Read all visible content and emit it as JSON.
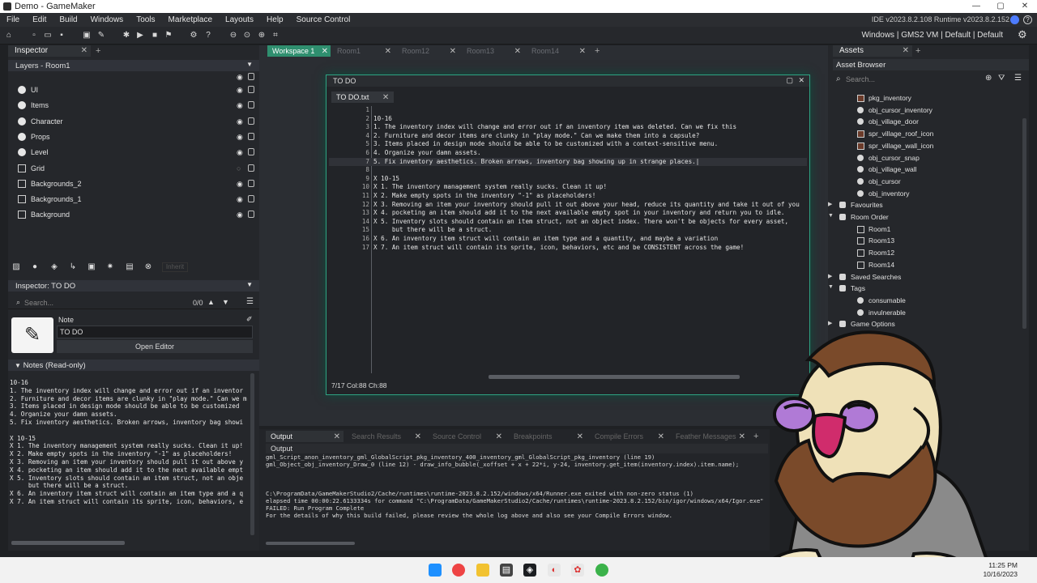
{
  "window": {
    "title": "Demo - GameMaker",
    "controls": [
      "—",
      "▢",
      "✕"
    ]
  },
  "menu": {
    "items": [
      "File",
      "Edit",
      "Build",
      "Windows",
      "Tools",
      "Marketplace",
      "Layouts",
      "Help",
      "Source Control"
    ],
    "version": "IDE v2023.8.2.108  Runtime v2023.8.2.152"
  },
  "toolbar": {
    "target": "Windows | GMS2 VM | Default | Default"
  },
  "inspector": {
    "tab": "Inspector",
    "layers_header": "Layers - Room1",
    "layers": [
      {
        "name": "UI",
        "icon": "circ",
        "visible": true
      },
      {
        "name": "Items",
        "icon": "circ",
        "visible": true
      },
      {
        "name": "Character",
        "icon": "circ",
        "visible": true
      },
      {
        "name": "Props",
        "icon": "circ",
        "visible": true
      },
      {
        "name": "Level",
        "icon": "circ",
        "visible": true
      },
      {
        "name": "Grid",
        "icon": "sq",
        "visible": false
      },
      {
        "name": "Backgrounds_2",
        "icon": "sq",
        "visible": true
      },
      {
        "name": "Backgrounds_1",
        "icon": "sq",
        "visible": true
      },
      {
        "name": "Background",
        "icon": "sq",
        "visible": true
      }
    ],
    "inherit_label": "Inherit",
    "inspector_header": "Inspector: TO DO",
    "search_placeholder": "Search...",
    "search_count": "0/0",
    "note_label": "Note",
    "note_name": "TO DO",
    "open_editor": "Open Editor",
    "notes_header": "Notes (Read-only)",
    "notes_text": "10-16\n1. The inventory index will change and error out if an inventor\n2. Furniture and decor items are clunky in \"play mode.\" Can we m\n3. Items placed in design mode should be able to be customized\n4. Organize your damn assets.\n5. Fix inventory aesthetics. Broken arrows, inventory bag showi\n\nX 10-15\nX 1. The inventory management system really sucks. Clean it up!\nX 2. Make empty spots in the inventory \"-1\" as placeholders!\nX 3. Removing an item your inventory should pull it out above y\nX 4. pocketing an item should add it to the next available empt\nX 5. Inventory slots should contain an item struct, not an obje\n     but there will be a struct.\nX 6. An inventory item struct will contain an item type and a q\nX 7. An item struct will contain its sprite, icon, behaviors, e"
  },
  "workspace": {
    "tabs": [
      "Workspace 1",
      "Room1",
      "Room12",
      "Room13",
      "Room14"
    ]
  },
  "editor": {
    "window_title": "TO DO",
    "file_tab": "TO DO.txt",
    "lines": [
      {
        "n": "1",
        "t": ""
      },
      {
        "n": "2",
        "t": "10-16"
      },
      {
        "n": "3",
        "t": "1. The inventory index will change and error out if an inventory item was deleted. Can we fix this"
      },
      {
        "n": "4",
        "t": "2. Furniture and decor items are clunky in \"play mode.\" Can we make them into a capsule?"
      },
      {
        "n": "5",
        "t": "3. Items placed in design mode should be able to be customized with a context-sensitive menu."
      },
      {
        "n": "6",
        "t": "4. Organize your damn assets."
      },
      {
        "n": "7",
        "t": "5. Fix inventory aesthetics. Broken arrows, inventory bag showing up in strange places.|"
      },
      {
        "n": "8",
        "t": ""
      },
      {
        "n": "9",
        "t": "X 10-15"
      },
      {
        "n": "10",
        "t": "X 1. The inventory management system really sucks. Clean it up!"
      },
      {
        "n": "11",
        "t": "X 2. Make empty spots in the inventory \"-1\" as placeholders!"
      },
      {
        "n": "12",
        "t": "X 3. Removing an item your inventory should pull it out above your head, reduce its quantity and take it out of you"
      },
      {
        "n": "13",
        "t": "X 4. pocketing an item should add it to the next available empty spot in your inventory and return you to idle."
      },
      {
        "n": "14",
        "t": "X 5. Inventory slots should contain an item struct, not an object index. There won't be objects for every asset,"
      },
      {
        "n": "15",
        "t": "     but there will be a struct."
      },
      {
        "n": "16",
        "t": "X 6. An inventory item struct will contain an item type and a quantity, and maybe a variation"
      },
      {
        "n": "17",
        "t": "X 7. An item struct will contain its sprite, icon, behaviors, etc and be CONSISTENT across the game!"
      }
    ],
    "status": "7/17 Col:88 Ch:88"
  },
  "output": {
    "tabs": [
      "Output",
      "Search Results",
      "Source Control",
      "Breakpoints",
      "Compile Errors",
      "Feather Messages"
    ],
    "subheader": "Output",
    "text": "gml_Script_anon_inventory_gml_GlobalScript_pkg_inventory_400_inventory_gml_GlobalScript_pkg_inventory (line 19)\ngml_Object_obj_inventory_Draw_0 (line 12) - draw_info_bubble(_xoffset + x + 22*i, y-24, inventory.get_item(inventory.index).item.name);\n\n\n\nC:\\ProgramData/GameMakerStudio2/Cache/runtimes\\runtime-2023.8.2.152/windows/x64/Runner.exe exited with non-zero status (1)\nelapsed time 00:00:22.6133334s for command \"C:\\ProgramData/GameMakerStudio2/Cache/runtimes\\runtime-2023.8.2.152/bin/igor/windows/x64/Igor.exe\" -j=8  -opti\nFAILED: Run Program Complete\nFor the details of why this build failed, please review the whole log above and also see your Compile Errors window."
  },
  "assets": {
    "tab": "Assets",
    "header": "Asset Browser",
    "search_placeholder": "Search...",
    "items": [
      {
        "name": "pkg_inventory",
        "kind": "sq",
        "indent": 44
      },
      {
        "name": "obj_cursor_inventory",
        "kind": "dot",
        "indent": 44
      },
      {
        "name": "obj_village_door",
        "kind": "dot",
        "indent": 44
      },
      {
        "name": "spr_village_roof_icon",
        "kind": "sq",
        "indent": 44
      },
      {
        "name": "spr_village_wall_icon",
        "kind": "sq",
        "indent": 44
      },
      {
        "name": "obj_cursor_snap",
        "kind": "dot",
        "indent": 44
      },
      {
        "name": "obj_village_wall",
        "kind": "dot",
        "indent": 44
      },
      {
        "name": "obj_cursor",
        "kind": "dot",
        "indent": 44
      },
      {
        "name": "obj_inventory",
        "kind": "dot",
        "indent": 44
      },
      {
        "name": "Favourites",
        "kind": "group",
        "indent": 22
      },
      {
        "name": "Room Order",
        "kind": "group-open",
        "indent": 22
      },
      {
        "name": "Room1",
        "kind": "room",
        "indent": 44
      },
      {
        "name": "Room13",
        "kind": "room",
        "indent": 44
      },
      {
        "name": "Room12",
        "kind": "room",
        "indent": 44
      },
      {
        "name": "Room14",
        "kind": "room",
        "indent": 44
      },
      {
        "name": "Saved Searches",
        "kind": "group",
        "indent": 22
      },
      {
        "name": "Tags",
        "kind": "group-open",
        "indent": 22
      },
      {
        "name": "consumable",
        "kind": "dot",
        "indent": 44
      },
      {
        "name": "invulnerable",
        "kind": "dot",
        "indent": 44
      },
      {
        "name": "Game Options",
        "kind": "group",
        "indent": 22
      }
    ]
  },
  "taskbar": {
    "time": "11:25 PM",
    "date": "10/16/2023"
  },
  "colors": {
    "accent": "#2ea383",
    "tab_active": "#2f8f6f",
    "panel": "#25272b"
  }
}
